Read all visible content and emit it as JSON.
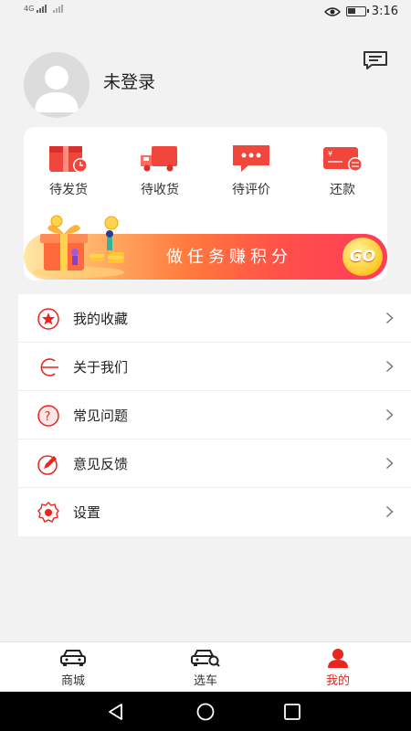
{
  "status_bar": {
    "network": "4G",
    "time": "3:16"
  },
  "profile": {
    "username": "未登录"
  },
  "orders": [
    {
      "label": "待发货",
      "icon": "package-calendar-icon"
    },
    {
      "label": "待收货",
      "icon": "delivery-truck-icon"
    },
    {
      "label": "待评价",
      "icon": "comment-bubble-icon"
    },
    {
      "label": "还款",
      "icon": "repayment-card-icon"
    }
  ],
  "banner": {
    "text": "做任务赚积分",
    "button": "GO"
  },
  "menu": [
    {
      "label": "我的收藏",
      "icon": "star-icon"
    },
    {
      "label": "关于我们",
      "icon": "about-us-icon"
    },
    {
      "label": "常见问题",
      "icon": "question-icon"
    },
    {
      "label": "意见反馈",
      "icon": "feedback-pencil-icon"
    },
    {
      "label": "设置",
      "icon": "settings-gear-icon"
    }
  ],
  "tabs": [
    {
      "label": "商城",
      "icon": "car-front-icon",
      "active": false
    },
    {
      "label": "选车",
      "icon": "car-search-icon",
      "active": false
    },
    {
      "label": "我的",
      "icon": "user-icon",
      "active": true
    }
  ],
  "colors": {
    "accent": "#e8251f",
    "background": "#f2f2f2"
  }
}
